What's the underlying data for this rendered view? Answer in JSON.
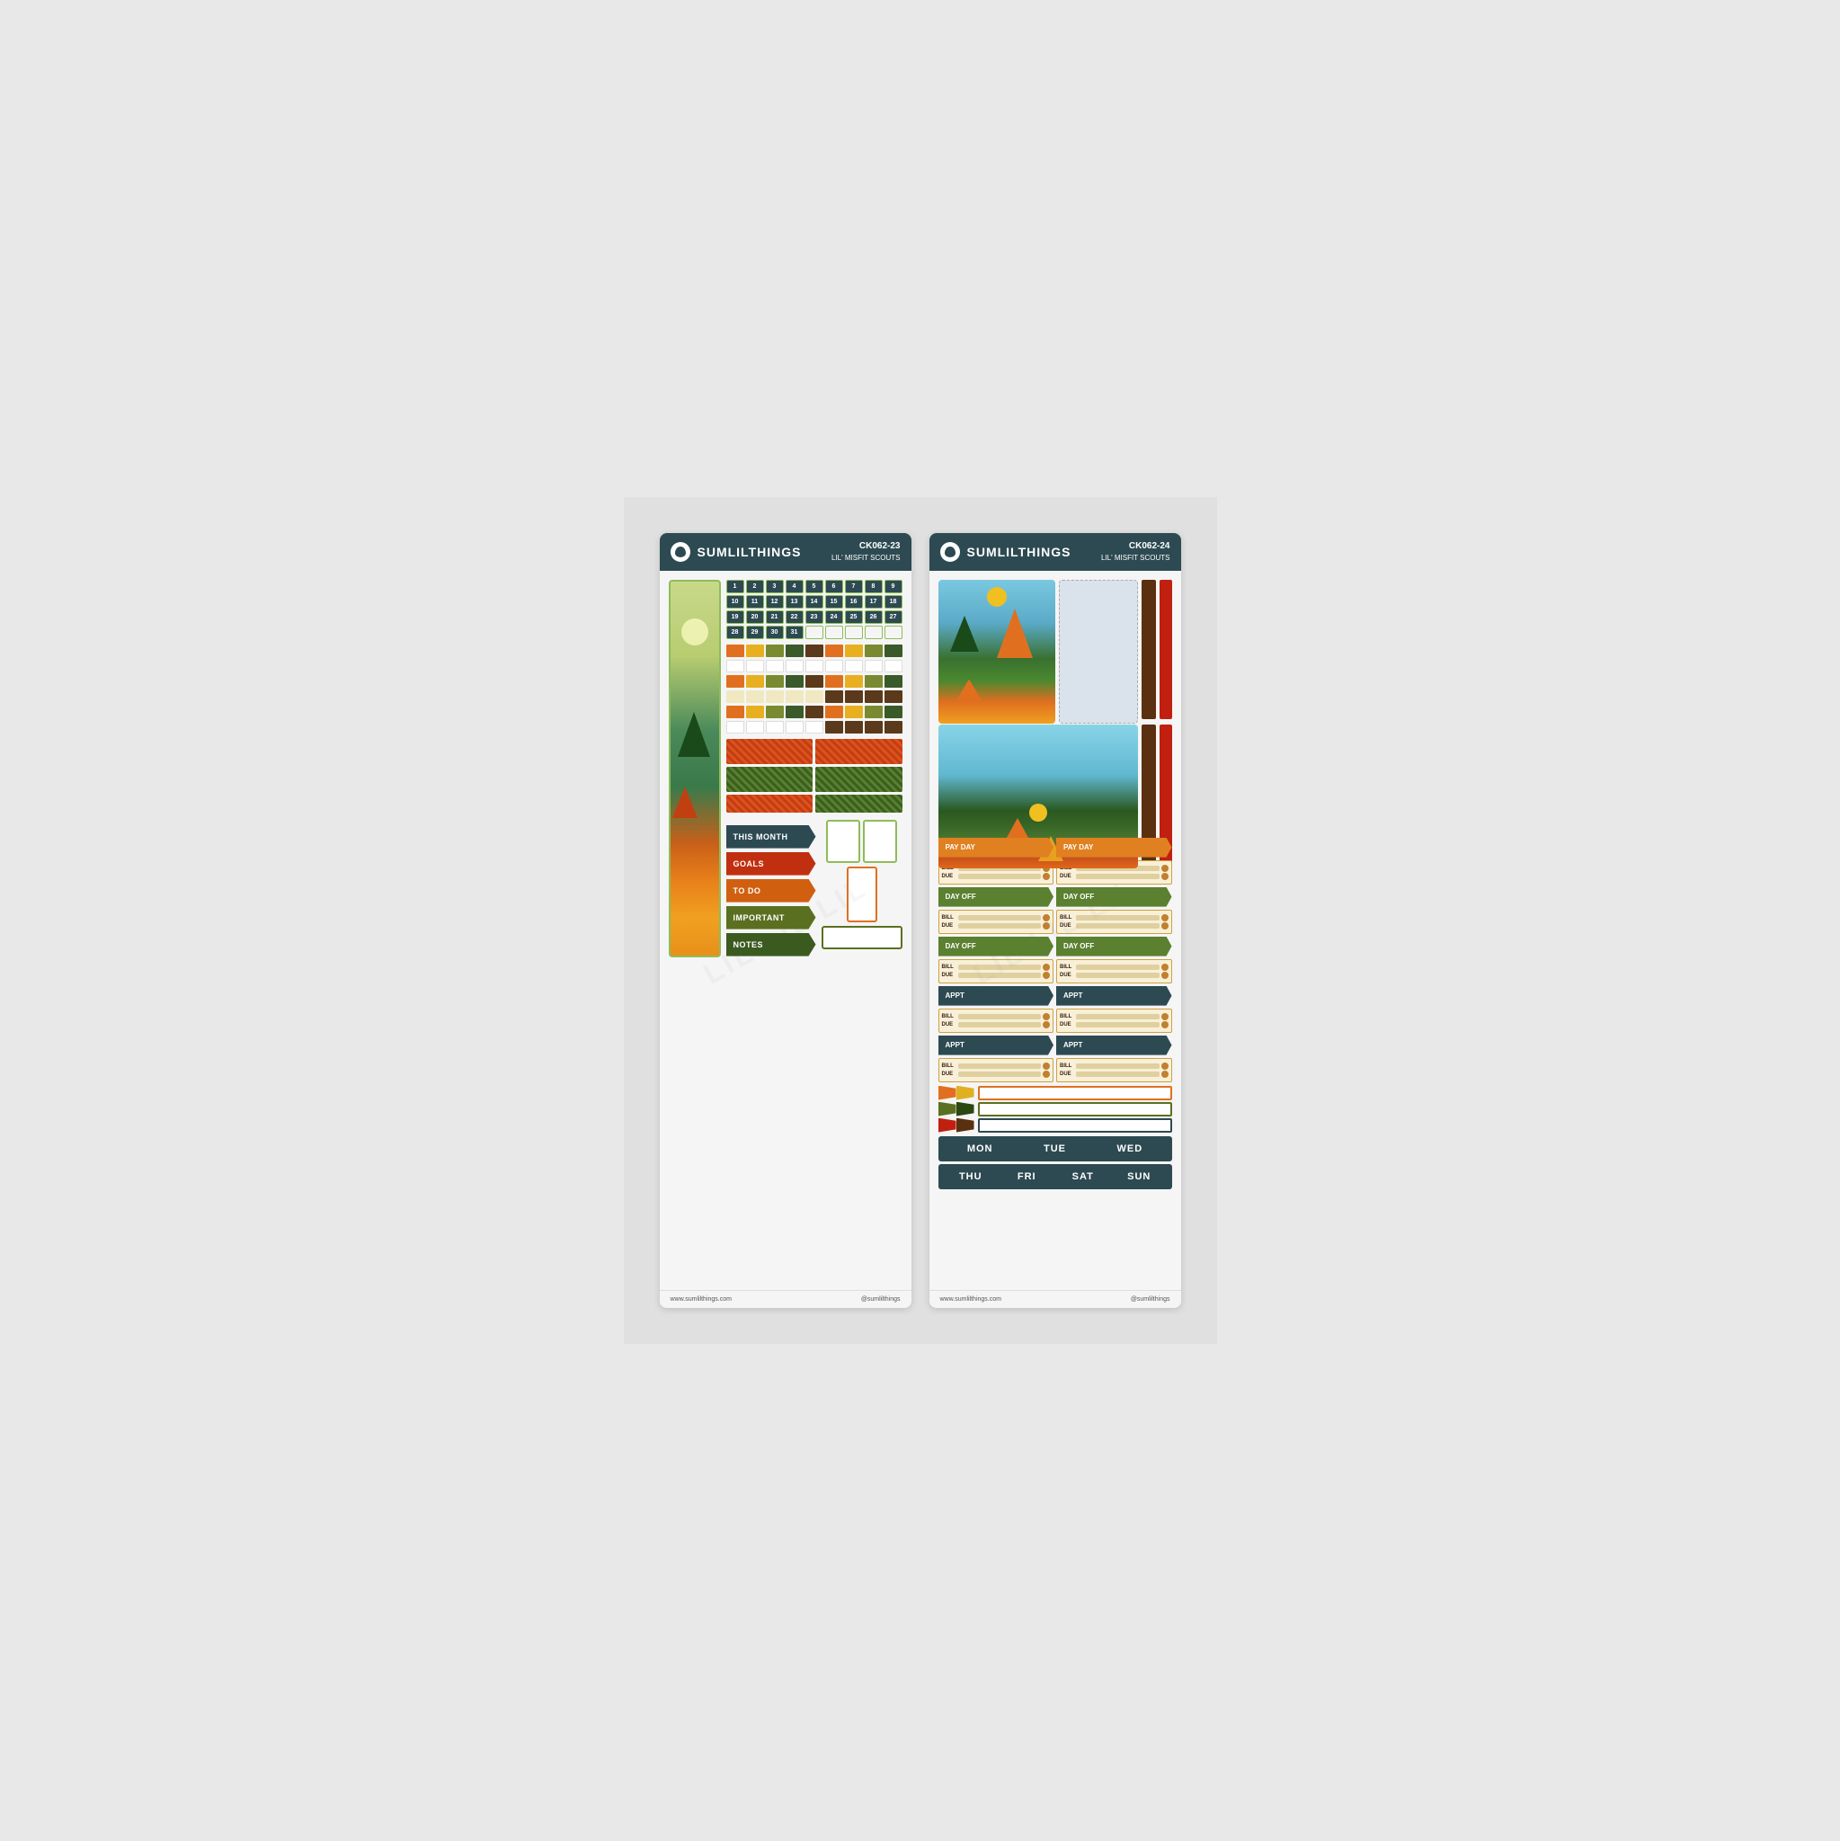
{
  "brand": "SUMLILTHINGS",
  "card1": {
    "code": "CK062-23",
    "subtitle": "LIL' MISFIT SCOUTS",
    "numbers": [
      1,
      2,
      3,
      4,
      5,
      6,
      7,
      8,
      9,
      10,
      11,
      12,
      13,
      14,
      15,
      16,
      17,
      18,
      19,
      20,
      21,
      22,
      23,
      24,
      25,
      26,
      27,
      28,
      29,
      30,
      31
    ],
    "banners": [
      {
        "label": "THIS MONTH",
        "color": "darkblue"
      },
      {
        "label": "GOALS",
        "color": "red"
      },
      {
        "label": "TO DO",
        "color": "orange"
      },
      {
        "label": "IMPORTANT",
        "color": "olive"
      },
      {
        "label": "NOTES",
        "color": "dgreen"
      }
    ],
    "footer_left": "www.sumlilthings.com",
    "footer_right": "@sumlilthings"
  },
  "card2": {
    "code": "CK062-24",
    "subtitle": "LIL' MISFIT SCOUTS",
    "functional_labels": [
      "PAY DAY",
      "PAY DAY",
      "DAY OFF",
      "DAY OFF",
      "DAY OFF",
      "DAY OFF",
      "APPT",
      "APPT",
      "APPT",
      "APPT"
    ],
    "days_row1": [
      "MON",
      "TUE",
      "WED"
    ],
    "days_row2": [
      "THU",
      "FRI",
      "SAT",
      "SUN"
    ],
    "bill_labels": [
      "BILL",
      "DUE"
    ],
    "footer_left": "www.sumlilthings.com",
    "footer_right": "@sumlilthings"
  }
}
